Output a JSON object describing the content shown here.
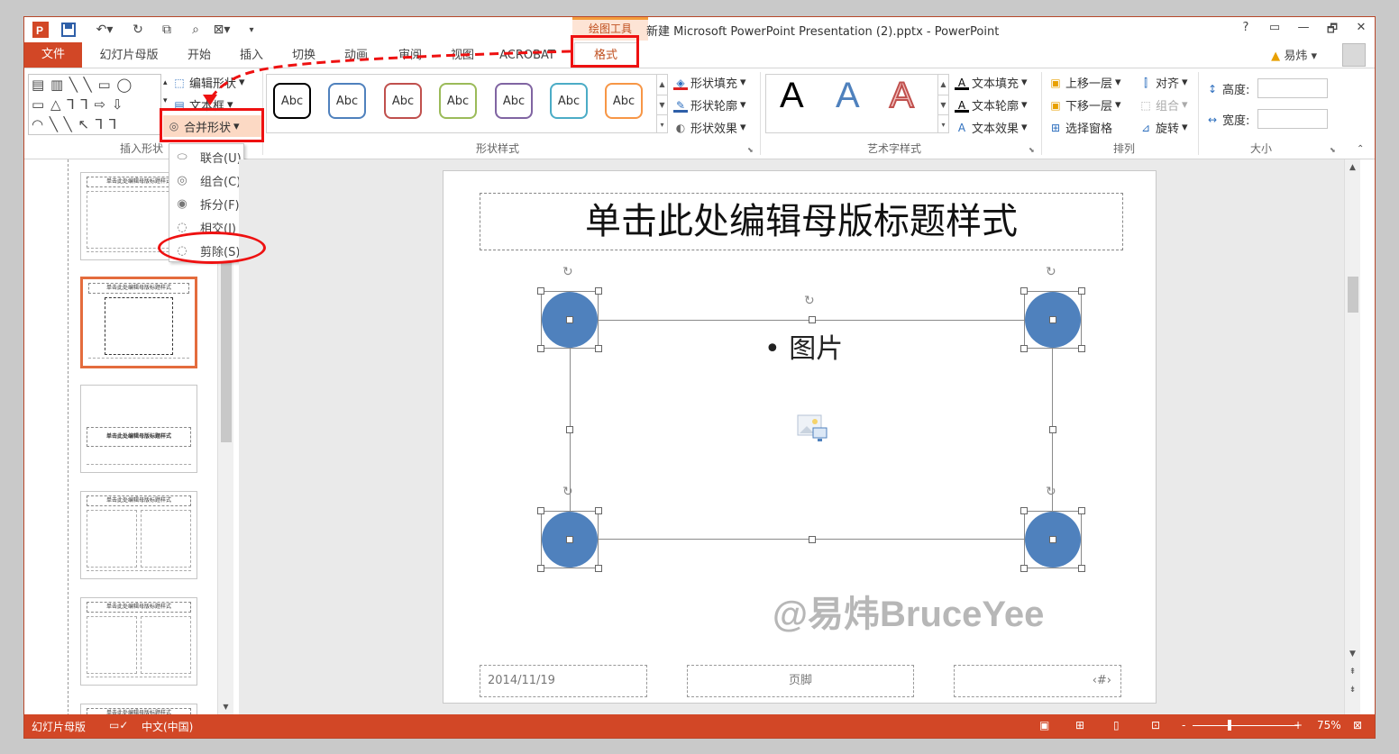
{
  "window": {
    "title": "新建 Microsoft PowerPoint Presentation (2).pptx - PowerPoint",
    "context_tool": "绘图工具",
    "help": "?",
    "controls": [
      "▭",
      "—",
      "🗗",
      "✕"
    ]
  },
  "quick_access": {
    "save_icon": "save-icon",
    "undo_icon": "undo-icon",
    "redo_icon": "redo-icon"
  },
  "tabs": [
    "文件",
    "幻灯片母版",
    "开始",
    "插入",
    "切换",
    "动画",
    "审阅",
    "视图",
    "ACROBAT",
    "格式"
  ],
  "user": {
    "name": "易炜",
    "warning_icon": "warning-icon"
  },
  "ribbon": {
    "insert_shapes": {
      "label": "插入形状",
      "edit_shape": "编辑形状",
      "text_box": "文本框",
      "merge_shapes": "合并形状",
      "shapes_row1": "▤ ▥ ╲ ╲ ▭ ◯",
      "shapes_row2": "▭ △ ⅂ ⅂ ⇨ ⇩",
      "shapes_row3": "◠ ╲ ╲ ↖ ⅂ ⅂"
    },
    "shape_styles": {
      "label": "形状样式",
      "sample": "Abc",
      "colors": [
        "#000000",
        "#4f81bd",
        "#c0504d",
        "#9bbb59",
        "#8064a2",
        "#4bacc6",
        "#f79646"
      ],
      "fill": "形状填充",
      "outline": "形状轮廓",
      "effects": "形状效果"
    },
    "wordart": {
      "label": "艺术字样式",
      "letters": [
        "A",
        "A",
        "A"
      ],
      "text_fill": "文本填充",
      "text_outline": "文本轮廓",
      "text_effects": "文本效果"
    },
    "arrange": {
      "label": "排列",
      "bring_forward": "上移一层",
      "send_backward": "下移一层",
      "selection_pane": "选择窗格",
      "align": "对齐",
      "group": "组合",
      "rotate": "旋转"
    },
    "size": {
      "label": "大小",
      "height": "高度:",
      "width": "宽度:"
    }
  },
  "merge_menu": [
    {
      "label": "联合(U)",
      "icon": "union-icon"
    },
    {
      "label": "组合(C)",
      "icon": "combine-icon"
    },
    {
      "label": "拆分(F)",
      "icon": "fragment-icon"
    },
    {
      "label": "相交(I)",
      "icon": "intersect-icon"
    },
    {
      "label": "剪除(S)",
      "icon": "subtract-icon"
    }
  ],
  "thumbnails": [
    {
      "title": "单击此处编辑母版标题样式"
    },
    {
      "title": "单击此处编辑母版标题样式"
    },
    {
      "title": "单击此处编辑母版标题样式"
    },
    {
      "title": "单击此处编辑母版标题样式"
    },
    {
      "title": "单击此处编辑母版标题样式"
    },
    {
      "title": "单击此处编辑母版标题样式"
    }
  ],
  "slide": {
    "title": "单击此处编辑母版标题样式",
    "bullet": "• 图片",
    "footer_date": "2014/11/19",
    "footer_text": "页脚",
    "footer_number": "‹#›"
  },
  "watermark": "@易炜BruceYee",
  "status": {
    "view": "幻灯片母版",
    "language": "中文(中国)",
    "zoom": "75%",
    "minus": "-",
    "plus": "+"
  },
  "colors": {
    "accent": "#d24726",
    "shape_fill": "#4f81bd",
    "annotation": "#ee1111"
  }
}
